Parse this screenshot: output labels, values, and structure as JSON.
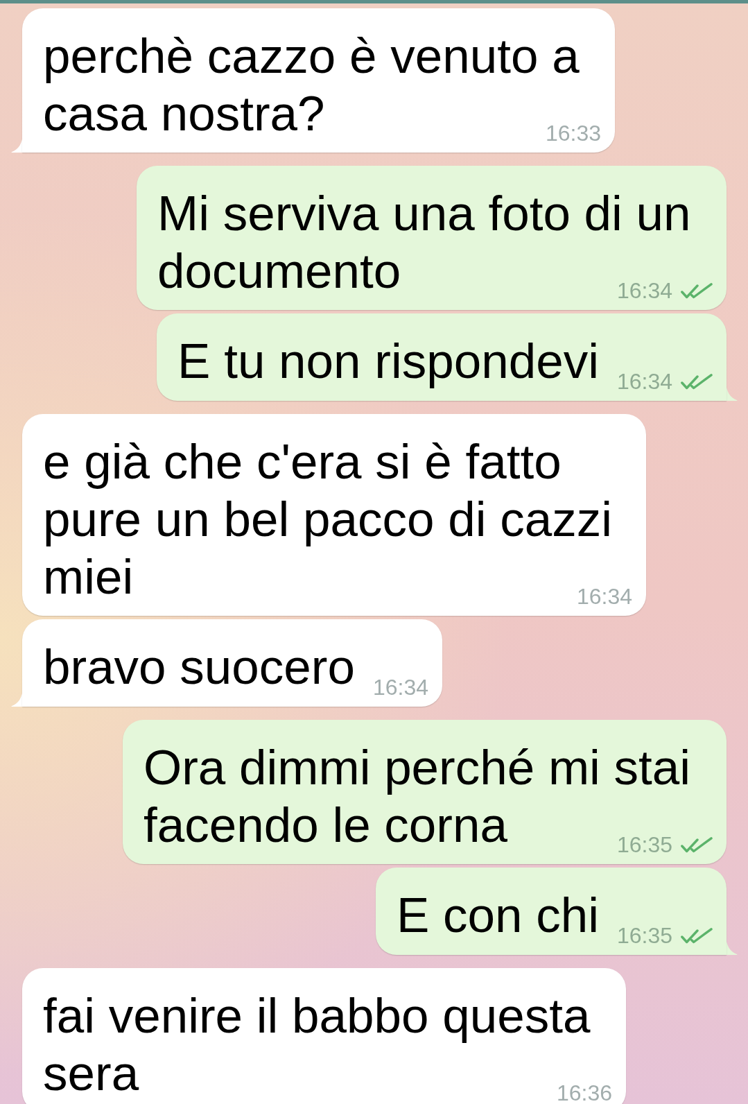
{
  "messages": [
    {
      "kind": "incoming",
      "text": "perchè cazzo è venuto a casa nostra?",
      "time": "16:33"
    },
    {
      "kind": "outgoing",
      "text": "Mi serviva una foto di un documento",
      "time": "16:34",
      "read": true
    },
    {
      "kind": "outgoing",
      "text": "E tu non rispondevi",
      "time": "16:34",
      "read": true
    },
    {
      "kind": "incoming",
      "text": "e già che c'era si è fatto pure un bel pacco di cazzi miei",
      "time": "16:34"
    },
    {
      "kind": "incoming",
      "text": "bravo suocero",
      "time": "16:34"
    },
    {
      "kind": "outgoing",
      "text": "Ora dimmi perché mi stai facendo le corna",
      "time": "16:35",
      "read": true
    },
    {
      "kind": "outgoing",
      "text": "E con chi",
      "time": "16:35",
      "read": true
    },
    {
      "kind": "incoming",
      "text": "fai venire il babbo questa sera",
      "time": "16:36"
    }
  ]
}
